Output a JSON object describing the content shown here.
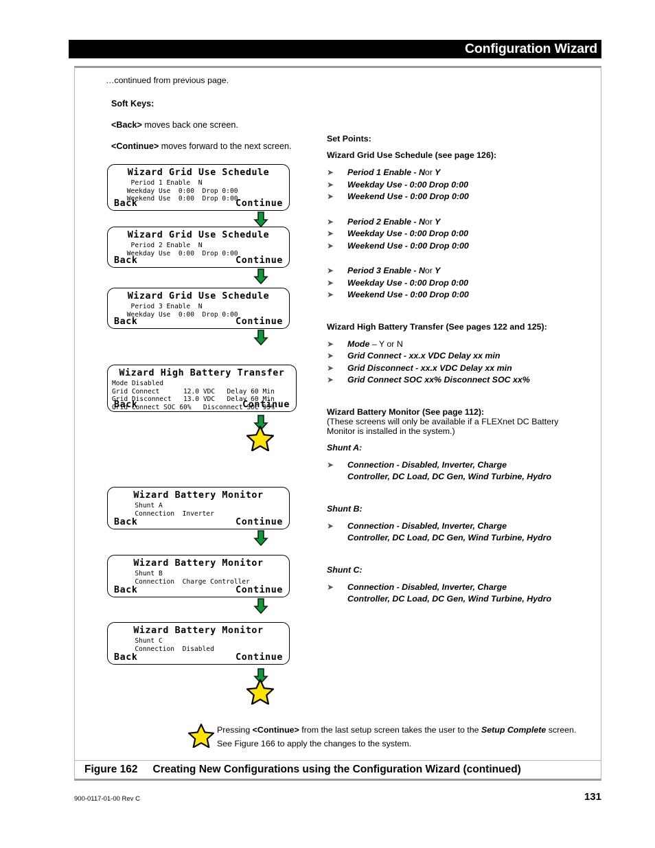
{
  "header": {
    "title": "Configuration Wizard"
  },
  "intro": {
    "continued_note": "…continued from previous page."
  },
  "soft_keys": {
    "title": "Soft Keys:",
    "back_key": "<Back>",
    "back_desc": " moves back one screen.",
    "continue_key": "<Continue>",
    "continue_desc": " moves forward to the next screen."
  },
  "screens": [
    {
      "title": "Wizard Grid Use Schedule",
      "body": "  Period 1 Enable  N\n Weekday Use  0:00  Drop 0:00\n Weekend Use  0:00  Drop 0:00",
      "back": "Back",
      "continue": "Continue"
    },
    {
      "title": "Wizard Grid Use Schedule",
      "body": "  Period 2 Enable  N\n Weekday Use  0:00  Drop 0:00",
      "back": "Back",
      "continue": "Continue"
    },
    {
      "title": "Wizard Grid Use Schedule",
      "body": "  Period 3 Enable  N\n Weekday Use  0:00  Drop 0:00",
      "back": "Back",
      "continue": "Continue"
    },
    {
      "title": "Wizard High Battery Transfer",
      "body": "Mode Disabled\nGrid Connect      12.0 VDC   Delay 60 Min\nGrid Disconnect   13.0 VDC   Delay 60 Min\nGrid Connect SOC 60%   Disconnect SOC 95%",
      "back": "Back",
      "continue": "Continue"
    },
    {
      "title": "Wizard Battery Monitor",
      "body": "   Shunt A\n   Connection  Inverter",
      "back": "Back",
      "continue": "Continue"
    },
    {
      "title": "Wizard Battery Monitor",
      "body": "   Shunt B\n   Connection  Charge Controller",
      "back": "Back",
      "continue": "Continue"
    },
    {
      "title": "Wizard Battery Monitor",
      "body": "   Shunt C\n   Connection  Disabled",
      "back": "Back",
      "continue": "Continue"
    }
  ],
  "set_points": {
    "heading": "Set Points:",
    "grid_use": {
      "heading": "Wizard Grid Use Schedule (see page 126):",
      "groups": [
        {
          "items": [
            {
              "bold": "Period 1 Enable - N",
              "regular": "or",
              "bold_tail": "Y"
            },
            {
              "bold": "Weekday Use - 0:00 Drop 0:00"
            },
            {
              "bold": "Weekend Use - 0:00 Drop 0:00"
            }
          ]
        },
        {
          "items": [
            {
              "bold": "Period 2 Enable - N",
              "regular": "or",
              "bold_tail": "Y"
            },
            {
              "bold": "Weekday Use - 0:00 Drop 0:00"
            },
            {
              "bold": "Weekend Use - 0:00 Drop 0:00"
            }
          ]
        },
        {
          "items": [
            {
              "bold": "Period 3 Enable - N",
              "regular": "or",
              "bold_tail": "Y"
            },
            {
              "bold": "Weekday Use - 0:00 Drop 0:00"
            },
            {
              "bold": "Weekend Use - 0:00 Drop 0:00"
            }
          ]
        }
      ]
    },
    "high_battery_transfer": {
      "heading": "Wizard High Battery Transfer (See pages 122 and 125):",
      "items": [
        {
          "bold": "Mode",
          "regular": "– Y or N"
        },
        {
          "bold": "Grid Connect - xx.x VDC  Delay xx min"
        },
        {
          "bold": "Grid Disconnect - xx.x VDC  Delay xx min"
        },
        {
          "bold": "Grid Connect SOC xx%  Disconnect SOC xx%"
        }
      ]
    },
    "battery_monitor": {
      "heading": "Wizard Battery Monitor (See page 112):",
      "note_line1": "(These screens will only be available if a FLEXnet DC Battery",
      "note_line2": "Monitor is installed in the system.)",
      "shunts": [
        {
          "label": "Shunt A:",
          "item_line1": "Connection -  Disabled, Inverter, Charge",
          "item_line2": "Controller, DC Load, DC Gen, Wind Turbine, Hydro"
        },
        {
          "label": "Shunt B:",
          "item_line1": "Connection -  Disabled, Inverter, Charge",
          "item_line2": "Controller, DC Load, DC Gen, Wind Turbine, Hydro"
        },
        {
          "label": "Shunt C:",
          "item_line1": "Connection -  Disabled, Inverter, Charge",
          "item_line2": "Controller, DC Load, DC Gen, Wind Turbine, Hydro"
        }
      ]
    }
  },
  "bottom_note": {
    "text_1": "Pressing ",
    "key": "<Continue>",
    "text_2": " from the last setup screen takes the user to the ",
    "emphasis": "Setup Complete",
    "text_3": " screen.  See Figure 166 to apply the changes to the system."
  },
  "figure": {
    "number": "Figure 162",
    "caption": "Creating New Configurations using the Configuration Wizard (continued)"
  },
  "footer": {
    "doc_id": "900-0117-01-00 Rev C",
    "page_number": "131"
  },
  "colors": {
    "arrow_green": "#0a9b34",
    "arrow_outline": "#1a1a1a",
    "star_yellow": "#ffe400",
    "star_outline": "#000000",
    "header_bar": "#000000",
    "frame_gray": "#9a9a9a"
  },
  "icons": {
    "down_arrow": "down-arrow-icon",
    "star": "star-icon"
  }
}
